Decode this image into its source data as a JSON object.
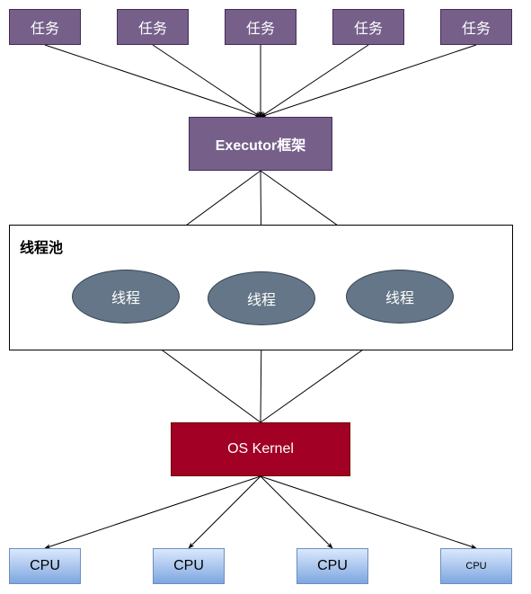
{
  "tasks": [
    {
      "label": "任务"
    },
    {
      "label": "任务"
    },
    {
      "label": "任务"
    },
    {
      "label": "任务"
    },
    {
      "label": "任务"
    }
  ],
  "executor": {
    "label": "Executor框架"
  },
  "thread_pool": {
    "title": "线程池",
    "threads": [
      {
        "label": "线程"
      },
      {
        "label": "线程"
      },
      {
        "label": "线程"
      }
    ]
  },
  "kernel": {
    "label": "OS Kernel"
  },
  "cpus": [
    {
      "label": "CPU"
    },
    {
      "label": "CPU"
    },
    {
      "label": "CPU"
    },
    {
      "label": "CPU"
    }
  ],
  "edges": [
    {
      "from": "task-1",
      "to": "executor"
    },
    {
      "from": "task-2",
      "to": "executor"
    },
    {
      "from": "task-3",
      "to": "executor"
    },
    {
      "from": "task-4",
      "to": "executor"
    },
    {
      "from": "task-5",
      "to": "executor"
    },
    {
      "from": "executor",
      "to": "thread-1"
    },
    {
      "from": "executor",
      "to": "thread-2"
    },
    {
      "from": "executor",
      "to": "thread-3"
    },
    {
      "from": "kernel",
      "to": "thread-1"
    },
    {
      "from": "kernel",
      "to": "thread-2"
    },
    {
      "from": "kernel",
      "to": "thread-3"
    },
    {
      "from": "kernel",
      "to": "cpu-1"
    },
    {
      "from": "kernel",
      "to": "cpu-2"
    },
    {
      "from": "kernel",
      "to": "cpu-3"
    },
    {
      "from": "kernel",
      "to": "cpu-4"
    }
  ],
  "colors": {
    "task_fill": "#76608a",
    "thread_fill": "#647687",
    "kernel_fill": "#a20025",
    "cpu_fill_top": "#dae8fc",
    "cpu_fill_bottom": "#7ea6e0"
  }
}
